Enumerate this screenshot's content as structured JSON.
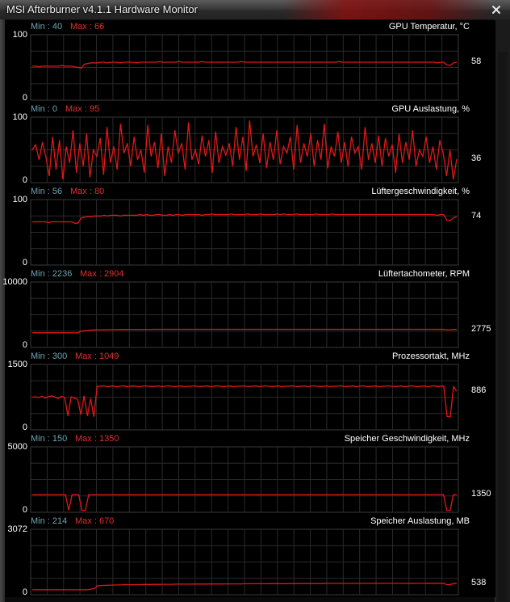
{
  "window": {
    "title": "MSI Afterburner v4.1.1 Hardware Monitor"
  },
  "colors": {
    "graph_line": "#e01818",
    "grid": "#2a2a2a",
    "min_label": "#6fa3b3",
    "max_label": "#e03030"
  },
  "graphs": [
    {
      "title": "GPU Temperatur, °C",
      "min_label": "Min : 40",
      "max_label": "Max : 66",
      "axis_top": "100",
      "axis_bottom": "0",
      "current": "58",
      "range": [
        0,
        100
      ],
      "values": [
        52,
        52,
        51,
        52,
        52,
        52,
        52,
        52,
        52,
        53,
        52,
        52,
        52,
        51,
        50,
        49,
        55,
        56,
        57,
        57,
        57,
        58,
        58,
        57,
        58,
        58,
        58,
        57,
        58,
        58,
        58,
        58,
        57,
        58,
        58,
        58,
        58,
        58,
        58,
        59,
        58,
        58,
        58,
        58,
        58,
        59,
        58,
        58,
        58,
        58,
        58,
        58,
        59,
        58,
        58,
        58,
        58,
        58,
        58,
        58,
        58,
        58,
        58,
        58,
        59,
        58,
        58,
        58,
        58,
        58,
        58,
        58,
        58,
        58,
        58,
        58,
        58,
        58,
        58,
        58,
        58,
        58,
        58,
        58,
        58,
        58,
        58,
        58,
        58,
        58,
        58,
        58,
        58,
        58,
        59,
        58,
        58,
        58,
        58,
        58,
        58,
        58,
        58,
        58,
        58,
        58,
        58,
        58,
        58,
        58,
        58,
        58,
        58,
        58,
        58,
        58,
        58,
        58,
        58,
        58,
        58,
        58,
        58,
        58,
        57,
        58,
        58,
        54,
        53,
        57,
        58
      ]
    },
    {
      "title": "GPU Auslastung, %",
      "min_label": "Min : 0",
      "max_label": "Max : 95",
      "axis_top": "100",
      "axis_bottom": "0",
      "current": "36",
      "range": [
        0,
        100
      ],
      "values": [
        50,
        58,
        35,
        62,
        40,
        10,
        70,
        20,
        65,
        5,
        55,
        30,
        80,
        15,
        60,
        25,
        75,
        8,
        50,
        40,
        68,
        12,
        85,
        30,
        55,
        20,
        90,
        45,
        60,
        25,
        70,
        35,
        50,
        15,
        88,
        40,
        62,
        22,
        75,
        10,
        55,
        30,
        80,
        45,
        60,
        20,
        92,
        35,
        50,
        28,
        72,
        40,
        65,
        15,
        78,
        30,
        55,
        42,
        60,
        25,
        85,
        35,
        70,
        18,
        95,
        40,
        58,
        30,
        75,
        22,
        62,
        35,
        80,
        28,
        55,
        45,
        70,
        20,
        88,
        30,
        60,
        40,
        75,
        25,
        65,
        35,
        90,
        22,
        55,
        40,
        78,
        30,
        62,
        25,
        70,
        45,
        55,
        20,
        85,
        35,
        60,
        30,
        72,
        25,
        68,
        40,
        58,
        15,
        75,
        30,
        62,
        35,
        80,
        25,
        50,
        40,
        70,
        30,
        55,
        20,
        65,
        45,
        10,
        50,
        5,
        36
      ]
    },
    {
      "title": "Lüftergeschwindigkeit, %",
      "min_label": "Min : 56",
      "max_label": "Max : 80",
      "axis_top": "100",
      "axis_bottom": "0",
      "current": "74",
      "range": [
        0,
        100
      ],
      "values": [
        66,
        66,
        66,
        66,
        66,
        65,
        66,
        66,
        66,
        66,
        66,
        66,
        66,
        64,
        64,
        72,
        73,
        74,
        74,
        75,
        75,
        75,
        76,
        75,
        76,
        76,
        76,
        75,
        76,
        76,
        76,
        76,
        76,
        77,
        76,
        77,
        76,
        76,
        77,
        77,
        76,
        76,
        77,
        76,
        77,
        77,
        76,
        77,
        77,
        77,
        77,
        77,
        76,
        77,
        77,
        78,
        77,
        77,
        77,
        77,
        77,
        78,
        77,
        77,
        77,
        77,
        78,
        77,
        77,
        77,
        78,
        77,
        77,
        77,
        77,
        78,
        77,
        78,
        77,
        77,
        77,
        78,
        77,
        77,
        77,
        77,
        77,
        78,
        77,
        77,
        77,
        77,
        78,
        77,
        77,
        77,
        77,
        77,
        77,
        77,
        77,
        77,
        77,
        77,
        77,
        77,
        77,
        77,
        77,
        77,
        77,
        77,
        77,
        77,
        77,
        77,
        77,
        77,
        77,
        77,
        77,
        77,
        77,
        77,
        76,
        77,
        77,
        68,
        68,
        72,
        74
      ]
    },
    {
      "title": "Lüftertachometer, RPM",
      "min_label": "Min : 2236",
      "max_label": "Max : 2904",
      "axis_top": "10000",
      "axis_bottom": "0",
      "current": "2775",
      "range": [
        0,
        10000
      ],
      "values": [
        2250,
        2250,
        2250,
        2250,
        2250,
        2250,
        2250,
        2250,
        2250,
        2250,
        2250,
        2250,
        2250,
        2240,
        2240,
        2500,
        2550,
        2600,
        2650,
        2680,
        2700,
        2700,
        2720,
        2720,
        2730,
        2730,
        2740,
        2740,
        2750,
        2750,
        2760,
        2760,
        2760,
        2770,
        2770,
        2770,
        2770,
        2780,
        2780,
        2780,
        2780,
        2780,
        2780,
        2780,
        2780,
        2780,
        2780,
        2780,
        2780,
        2780,
        2780,
        2780,
        2780,
        2780,
        2780,
        2780,
        2780,
        2780,
        2780,
        2780,
        2780,
        2780,
        2780,
        2780,
        2780,
        2780,
        2780,
        2780,
        2780,
        2780,
        2780,
        2780,
        2780,
        2780,
        2780,
        2780,
        2780,
        2780,
        2780,
        2780,
        2780,
        2780,
        2780,
        2780,
        2780,
        2780,
        2780,
        2780,
        2780,
        2780,
        2780,
        2780,
        2780,
        2780,
        2780,
        2780,
        2780,
        2780,
        2780,
        2780,
        2780,
        2780,
        2780,
        2780,
        2780,
        2780,
        2780,
        2780,
        2780,
        2780,
        2780,
        2780,
        2780,
        2780,
        2780,
        2780,
        2780,
        2780,
        2780,
        2780,
        2780,
        2780,
        2780,
        2780,
        2780,
        2780,
        2780,
        2700,
        2700,
        2750,
        2775
      ]
    },
    {
      "title": "Prozessortakt, MHz",
      "min_label": "Min : 300",
      "max_label": "Max : 1049",
      "axis_top": "1500",
      "axis_bottom": "0",
      "current": "886",
      "range": [
        0,
        1500
      ],
      "values": [
        750,
        760,
        740,
        770,
        730,
        760,
        780,
        750,
        720,
        770,
        740,
        320,
        760,
        730,
        700,
        350,
        780,
        320,
        720,
        300,
        1000,
        1000,
        1010,
        990,
        1000,
        1005,
        990,
        1000,
        1010,
        995,
        1000,
        1005,
        1000,
        990,
        1000,
        1010,
        1000,
        995,
        1000,
        1005,
        990,
        1000,
        1010,
        1000,
        995,
        1000,
        1005,
        990,
        1000,
        1000,
        1010,
        1000,
        995,
        1000,
        1005,
        990,
        1000,
        1010,
        1000,
        995,
        1000,
        1005,
        990,
        1000,
        1000,
        1010,
        1000,
        995,
        1000,
        1005,
        990,
        1000,
        1010,
        1000,
        995,
        1000,
        1005,
        990,
        1000,
        1000,
        1010,
        1000,
        995,
        1000,
        1005,
        990,
        1000,
        1010,
        1000,
        995,
        1000,
        1005,
        990,
        1000,
        1000,
        1010,
        1000,
        995,
        1000,
        1005,
        990,
        1000,
        1010,
        1000,
        995,
        1000,
        1005,
        990,
        1000,
        1000,
        1010,
        1000,
        995,
        1000,
        1005,
        990,
        1000,
        1010,
        1000,
        995,
        1000,
        1005,
        990,
        1000,
        1010,
        995,
        1000,
        1005,
        310,
        300,
        990,
        886
      ]
    },
    {
      "title": "Speicher Geschwindigkeit, MHz",
      "min_label": "Min : 150",
      "max_label": "Max : 1350",
      "axis_top": "5000",
      "axis_bottom": "0",
      "current": "1350",
      "range": [
        0,
        5000
      ],
      "values": [
        1350,
        1350,
        1350,
        1350,
        1350,
        1350,
        1350,
        1350,
        1350,
        1350,
        1350,
        150,
        1350,
        1350,
        1350,
        150,
        150,
        1350,
        1350,
        1350,
        1350,
        1350,
        1350,
        1350,
        1350,
        1350,
        1350,
        1350,
        1350,
        1350,
        1350,
        1350,
        1350,
        1350,
        1350,
        1350,
        1350,
        1350,
        1350,
        1350,
        1350,
        1350,
        1350,
        1350,
        1350,
        1350,
        1350,
        1350,
        1350,
        1350,
        1350,
        1350,
        1350,
        1350,
        1350,
        1350,
        1350,
        1350,
        1350,
        1350,
        1350,
        1350,
        1350,
        1350,
        1350,
        1350,
        1350,
        1350,
        1350,
        1350,
        1350,
        1350,
        1350,
        1350,
        1350,
        1350,
        1350,
        1350,
        1350,
        1350,
        1350,
        1350,
        1350,
        1350,
        1350,
        1350,
        1350,
        1350,
        1350,
        1350,
        1350,
        1350,
        1350,
        1350,
        1350,
        1350,
        1350,
        1350,
        1350,
        1350,
        1350,
        1350,
        1350,
        1350,
        1350,
        1350,
        1350,
        1350,
        1350,
        1350,
        1350,
        1350,
        1350,
        1350,
        1350,
        1350,
        1350,
        1350,
        1350,
        1350,
        1350,
        1350,
        1350,
        1350,
        1350,
        150,
        150,
        1350,
        1350
      ]
    },
    {
      "title": "Speicher Auslastung, MB",
      "min_label": "Min : 214",
      "max_label": "Max : 670",
      "axis_top": "3072",
      "axis_bottom": "0",
      "current": "538",
      "range": [
        0,
        3072
      ],
      "values": [
        230,
        230,
        230,
        230,
        230,
        230,
        230,
        230,
        230,
        230,
        230,
        230,
        230,
        230,
        230,
        230,
        230,
        230,
        260,
        290,
        420,
        430,
        440,
        445,
        450,
        455,
        460,
        460,
        465,
        470,
        470,
        470,
        475,
        475,
        480,
        480,
        480,
        485,
        485,
        485,
        490,
        490,
        490,
        490,
        495,
        495,
        495,
        495,
        495,
        500,
        500,
        500,
        500,
        500,
        505,
        505,
        505,
        505,
        505,
        510,
        510,
        510,
        510,
        510,
        510,
        515,
        515,
        515,
        515,
        515,
        515,
        515,
        520,
        520,
        520,
        520,
        520,
        520,
        520,
        520,
        520,
        525,
        525,
        525,
        525,
        525,
        525,
        525,
        525,
        525,
        530,
        530,
        530,
        530,
        530,
        530,
        530,
        530,
        530,
        530,
        530,
        530,
        535,
        535,
        535,
        535,
        535,
        535,
        535,
        535,
        535,
        535,
        535,
        535,
        535,
        535,
        535,
        535,
        535,
        535,
        535,
        540,
        540,
        540,
        540,
        540,
        540,
        470,
        480,
        520,
        538
      ]
    }
  ]
}
